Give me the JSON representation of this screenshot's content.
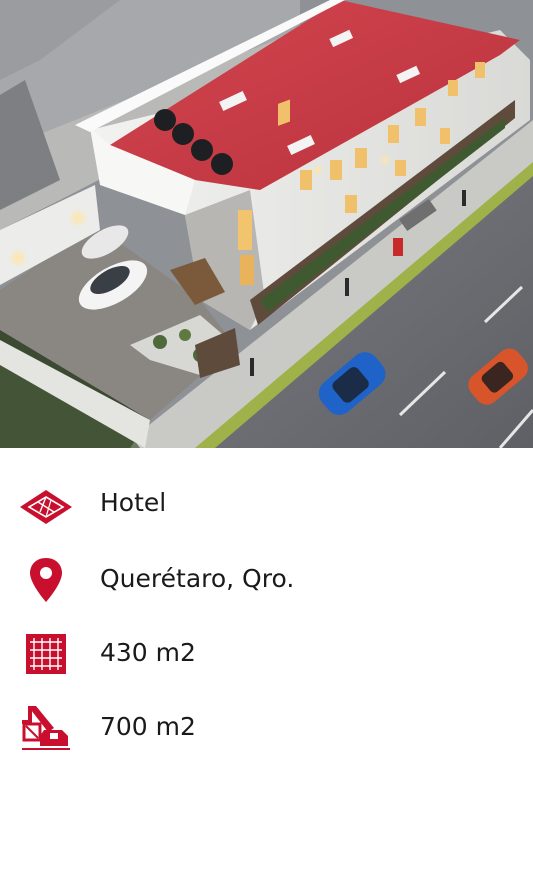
{
  "hero": {
    "image": "aerial-rendering-hotel"
  },
  "details": [
    {
      "icon": "floor-plan-icon",
      "text": "Hotel"
    },
    {
      "icon": "location-pin-icon",
      "text": "Querétaro, Qro."
    },
    {
      "icon": "grid-area-icon",
      "text": "430 m2"
    },
    {
      "icon": "crane-construction-icon",
      "text": "700 m2"
    }
  ],
  "colors": {
    "accent": "#c8102e",
    "text": "#1a1a1a",
    "background": "#ffffff"
  }
}
